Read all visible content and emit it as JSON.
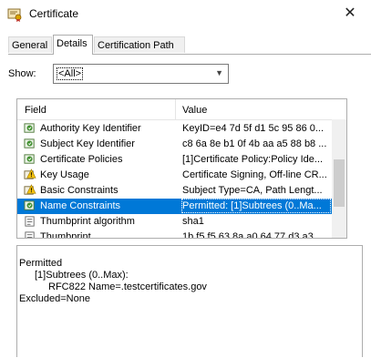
{
  "window": {
    "title": "Certificate",
    "close_glyph": "✕"
  },
  "tabs": [
    {
      "label": "General",
      "active": false
    },
    {
      "label": "Details",
      "active": true
    },
    {
      "label": "Certification Path",
      "active": false
    }
  ],
  "show": {
    "label": "Show:",
    "selected": "<All>"
  },
  "list": {
    "columns": [
      "Field",
      "Value"
    ],
    "rows": [
      {
        "field": "Authority Key Identifier",
        "value": "KeyID=e4 7d 5f d1 5c 95 86 0...",
        "icon": "extension-icon",
        "selected": false
      },
      {
        "field": "Subject Key Identifier",
        "value": "c8 6a 8e b1 0f 4b aa a5 88 b8 ...",
        "icon": "extension-icon",
        "selected": false
      },
      {
        "field": "Certificate Policies",
        "value": "[1]Certificate Policy:Policy Ide...",
        "icon": "extension-icon",
        "selected": false
      },
      {
        "field": "Key Usage",
        "value": "Certificate Signing, Off-line CR...",
        "icon": "critical-extension-icon",
        "selected": false
      },
      {
        "field": "Basic Constraints",
        "value": "Subject Type=CA, Path Lengt...",
        "icon": "critical-extension-icon",
        "selected": false
      },
      {
        "field": "Name Constraints",
        "value": "Permitted: [1]Subtrees (0..Ma...",
        "icon": "extension-icon",
        "selected": true
      },
      {
        "field": "Thumbprint algorithm",
        "value": "sha1",
        "icon": "property-icon",
        "selected": false
      },
      {
        "field": "Thumbprint",
        "value": "1b f5 f5 63 8a a0 64 77 d3 a3 ...",
        "icon": "property-icon",
        "selected": false
      }
    ]
  },
  "details": {
    "lines": [
      "Permitted",
      "[1]Subtrees (0..Max):",
      "RFC822 Name=.testcertificates.gov",
      "Excluded=None"
    ]
  },
  "colors": {
    "selection": "#0078d7",
    "border": "#adadad"
  }
}
